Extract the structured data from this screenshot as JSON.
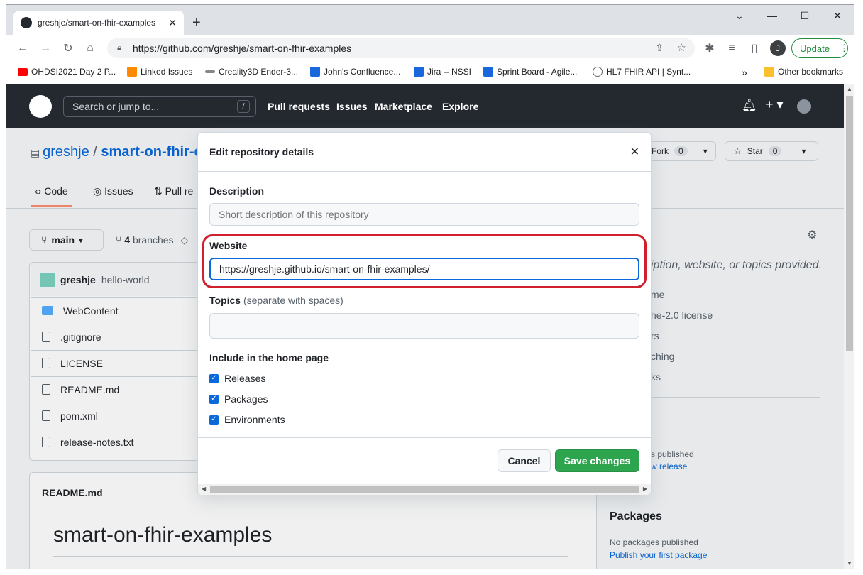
{
  "browser": {
    "tab_title": "greshje/smart-on-fhir-examples",
    "url": "https://github.com/greshje/smart-on-fhir-examples",
    "update_label": "Update",
    "profile_initial": "J",
    "bookmarks": [
      {
        "label": "OHDSI2021 Day 2 P...",
        "color": "#ff0000"
      },
      {
        "label": "Linked Issues",
        "color": "#ff8a00"
      },
      {
        "label": "Creality3D Ender-3...",
        "color": "#888888"
      },
      {
        "label": "John's Confluence...",
        "color": "#1868db"
      },
      {
        "label": "Jira -- NSSI",
        "color": "#1868db"
      },
      {
        "label": "Sprint Board - Agile...",
        "color": "#1868db"
      },
      {
        "label": "HL7 FHIR API | Synt...",
        "color": "#666666"
      }
    ],
    "overflow_label": "»",
    "other_bookmarks": "Other bookmarks"
  },
  "github": {
    "search_placeholder": "Search or jump to...",
    "search_key": "/",
    "nav": [
      "Pull requests",
      "Issues",
      "Marketplace",
      "Explore"
    ],
    "owner": "greshje",
    "separator": "/",
    "repo": "smart-on-fhir-e",
    "fork_label": "Fork",
    "fork_count": "0",
    "star_label": "Star",
    "star_count": "0",
    "tabs": [
      "Code",
      "Issues",
      "Pull re"
    ],
    "branch": "main",
    "branches_count": "4",
    "branches_label": "branches",
    "commit_author": "greshje",
    "commit_message": "hello-world",
    "files": [
      "WebContent",
      ".gitignore",
      "LICENSE",
      "README.md",
      "pom.xml",
      "release-notes.txt"
    ],
    "readme_label": "README.md",
    "readme_title": "smart-on-fhir-examples",
    "about_text": "iption, website, or topics provided.",
    "about_items": [
      "me",
      "he-2.0 license",
      "rs",
      "ching",
      "ks"
    ],
    "releases_text": "s published",
    "releases_link": "w release",
    "packages_heading": "Packages",
    "packages_text": "No packages published",
    "packages_link": "Publish your first package"
  },
  "modal": {
    "title": "Edit repository details",
    "description_label": "Description",
    "description_placeholder": "Short description of this repository",
    "website_label": "Website",
    "website_value": "https://greshje.github.io/smart-on-fhir-examples/",
    "topics_label": "Topics",
    "topics_hint": "(separate with spaces)",
    "include_label": "Include in the home page",
    "checkboxes": [
      {
        "label": "Releases",
        "checked": true
      },
      {
        "label": "Packages",
        "checked": true
      },
      {
        "label": "Environments",
        "checked": true
      }
    ],
    "cancel_label": "Cancel",
    "save_label": "Save changes"
  },
  "colors": {
    "highlight": "#d0202e",
    "save_green": "#2da44e",
    "header_dark": "#24292f",
    "link_blue": "#0969da"
  }
}
